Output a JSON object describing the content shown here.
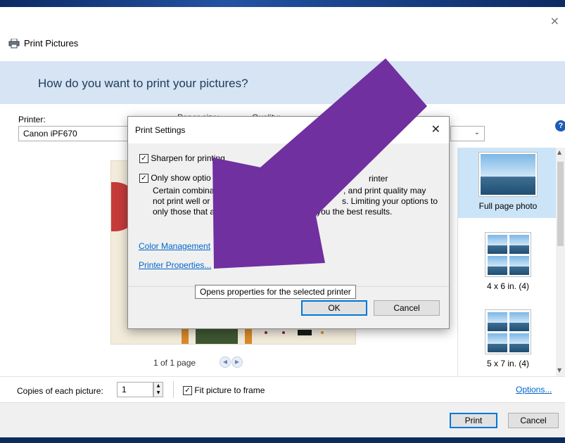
{
  "window": {
    "title": "Print Pictures",
    "close": "×",
    "banner": "How do you want to print your pictures?"
  },
  "options": {
    "printer_label": "Printer:",
    "printer_value": "Canon iPF670",
    "paper_size_label": "Paper size:",
    "quality_label": "Quality:"
  },
  "preview": {
    "page_text": "1 of 1 page"
  },
  "layouts": [
    {
      "label": "Full page photo",
      "selected": true
    },
    {
      "label": "4 x 6 in. (4)",
      "selected": false
    },
    {
      "label": "5 x 7 in. (4)",
      "selected": false
    }
  ],
  "footer": {
    "copies_label": "Copies of each picture:",
    "copies_value": "1",
    "fit_label": "Fit picture to frame",
    "fit_checked": true,
    "options_link": "Options...",
    "print_button": "Print",
    "cancel_button": "Cancel"
  },
  "dialog": {
    "title": "Print Settings",
    "sharpen_label": "Sharpen for printing",
    "sharpen_checked": true,
    "only_show_label": "Only show options that are compatible with my printer",
    "only_show_checked": true,
    "description": "Certain combinations of paper size, paper type, and print quality may not print well or produce unexpected results. Limiting your options to only those that are compatible will give you the best results.",
    "desc_line1": "Certain combina",
    "desc_line1b": ", and print quality may",
    "desc_line2": "not print well or",
    "desc_line2b": "s.  Limiting your options to",
    "desc_line3": "only those that a",
    "desc_line3b": "you the best results.",
    "only_show_visible_a": "Only show optio",
    "only_show_visible_b": "hat a",
    "only_show_visible_c": "rinter",
    "color_management_link": "Color Management",
    "printer_properties_link": "Printer Properties...",
    "ok_button": "OK",
    "cancel_button": "Cancel",
    "tooltip": "Opens properties for the selected printer"
  },
  "colors": {
    "arrow": "#7030a0",
    "banner": "#d6e4f3",
    "link": "#0066cc"
  }
}
